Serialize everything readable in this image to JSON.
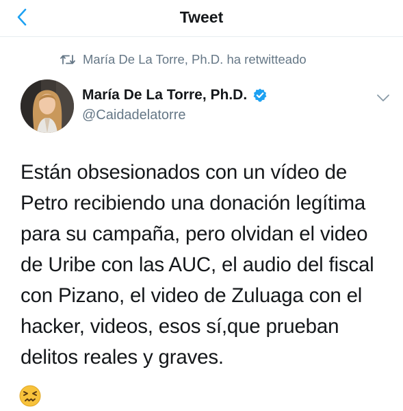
{
  "header": {
    "title": "Tweet",
    "back_icon": "chevron-left-icon",
    "accent_color": "#1da1f2"
  },
  "retweet": {
    "icon": "retweet-icon",
    "text": "María De La Torre, Ph.D. ha retwitteado"
  },
  "author": {
    "display_name": "María De La Torre, Ph.D.",
    "handle": "@Caidadelatorre",
    "verified": true,
    "verified_icon": "verified-badge-icon",
    "menu_icon": "chevron-down-icon"
  },
  "tweet": {
    "lines": [
      "Están obsesionados con un vídeo de",
      "Petro recibiendo una donación legítima",
      "para su campaña, pero olvidan el video",
      "de Uribe con las AUC, el audio del fiscal",
      "con Pizano, el video de Zuluaga con el",
      "hacker, videos, esos sí,que prueban",
      "delitos reales y graves."
    ],
    "emoji": "confounded-face-emoji"
  },
  "colors": {
    "text": "#14171a",
    "secondary": "#657786",
    "accent": "#1da1f2",
    "divider": "#e6ecf0"
  }
}
